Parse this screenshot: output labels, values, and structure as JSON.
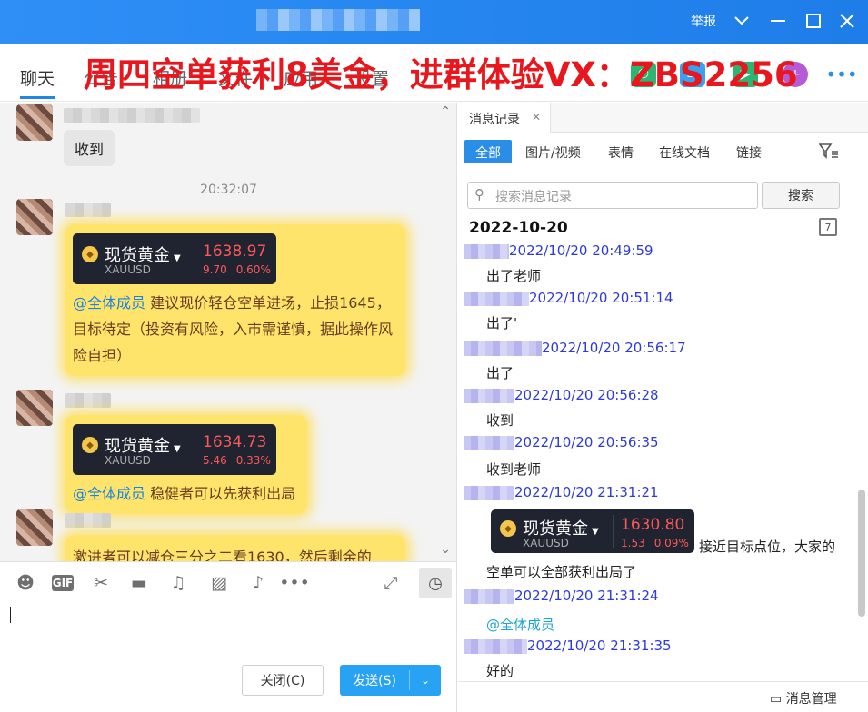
{
  "window": {
    "report_label": "举报",
    "colors": {
      "titlebar": "#1e7de8",
      "accent": "#2a8ee9"
    }
  },
  "promo_overlay": "周四空单获利8美金，进群体验VX：ZBS2256",
  "nav": {
    "chat_tab": "聊天",
    "hidden_tabs": [
      "公告",
      "相册",
      "文件",
      "应用",
      "设置"
    ]
  },
  "chat": {
    "messages": [
      {
        "text": "收到"
      }
    ],
    "timestamp": "20:32:07",
    "gold_messages": [
      {
        "quote": {
          "name": "现货黄金",
          "symbol": "XAUUSD",
          "price": "1638.97",
          "change": "9.70",
          "pct": "0.60%"
        },
        "mention": "@全体成员",
        "text": "建议现价轻仓空单进场，止损1645，目标待定（投资有风险，入市需谨慎，据此操作风险自担）"
      },
      {
        "quote": {
          "name": "现货黄金",
          "symbol": "XAUUSD",
          "price": "1634.73",
          "change": "5.46",
          "pct": "0.33%"
        },
        "mention": "@全体成员",
        "text": "稳健者可以先获利出局"
      },
      {
        "text": "激进者可以减仓三分之二看1630，然后剩余的"
      }
    ]
  },
  "toolbar": {
    "icons": [
      "emoji-icon",
      "gif-icon",
      "scissors-icon",
      "folder-icon",
      "music-icon",
      "image-icon",
      "bell-off-icon",
      "more-icon",
      "expand-icon",
      "clock-icon"
    ],
    "gif_label": "GIF"
  },
  "input": {
    "close_label": "关闭(C)",
    "send_label": "发送(S)"
  },
  "history": {
    "tab_label": "消息记录",
    "filters": [
      "全部",
      "图片/视频",
      "表情",
      "在线文档",
      "链接"
    ],
    "search_placeholder": "搜索消息记录",
    "search_button": "搜索",
    "date": "2022-10-20",
    "records": [
      {
        "time": "2022/10/20 20:49:59",
        "text": "出了老师"
      },
      {
        "time": "2022/10/20 20:51:14",
        "text": "出了'"
      },
      {
        "time": "2022/10/20 20:56:17",
        "text": "出了"
      },
      {
        "time": "2022/10/20 20:56:28",
        "text": "收到"
      },
      {
        "time": "2022/10/20 20:56:35",
        "text": "收到老师"
      },
      {
        "time": "2022/10/20 21:31:21",
        "text": "接近目标点位，大家的",
        "text2": "空单可以全部获利出局了"
      },
      {
        "time": "2022/10/20 21:31:24",
        "text": "@全体成员"
      },
      {
        "time": "2022/10/20 21:31:35",
        "text": "好的"
      }
    ],
    "quote": {
      "name": "现货黄金",
      "symbol": "XAUUSD",
      "price": "1630.80",
      "change": "1.53",
      "pct": "0.09%"
    },
    "footer_label": "消息管理"
  }
}
